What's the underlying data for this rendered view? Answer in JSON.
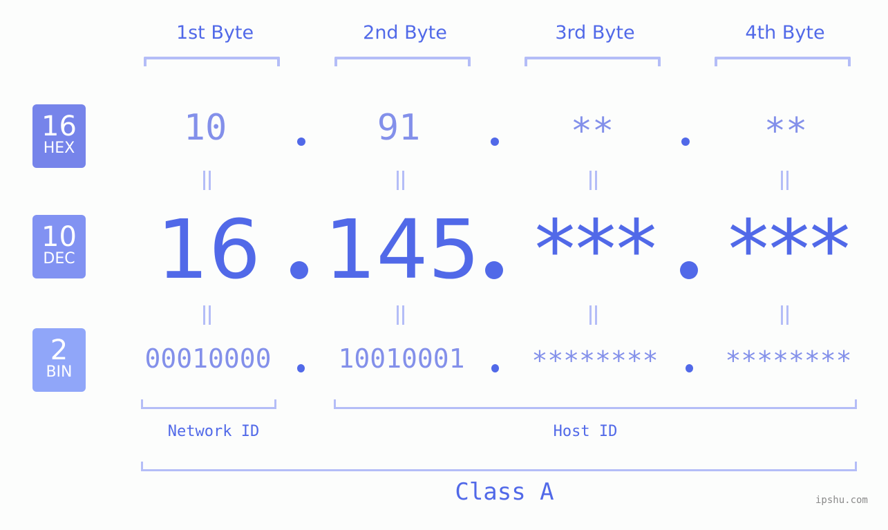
{
  "bytes": {
    "headers": [
      "1st Byte",
      "2nd Byte",
      "3rd Byte",
      "4th Byte"
    ]
  },
  "rows": {
    "hex": {
      "base": "16",
      "label": "HEX",
      "values": [
        "10",
        "91",
        "**",
        "**"
      ],
      "color": "#7684ea"
    },
    "dec": {
      "base": "10",
      "label": "DEC",
      "values": [
        "16",
        "145",
        "***",
        "***"
      ],
      "color": "#8192f2"
    },
    "bin": {
      "base": "2",
      "label": "BIN",
      "values": [
        "00010000",
        "10010001",
        "********",
        "********"
      ],
      "color": "#90a6f9"
    }
  },
  "separator": ".",
  "segments": {
    "network": "Network ID",
    "host": "Host ID",
    "class": "Class A"
  },
  "watermark": "ipshu.com",
  "colors": {
    "accent": "#5169e8",
    "muted_value": "#8390ea",
    "bracket": "#b4bdf7"
  }
}
